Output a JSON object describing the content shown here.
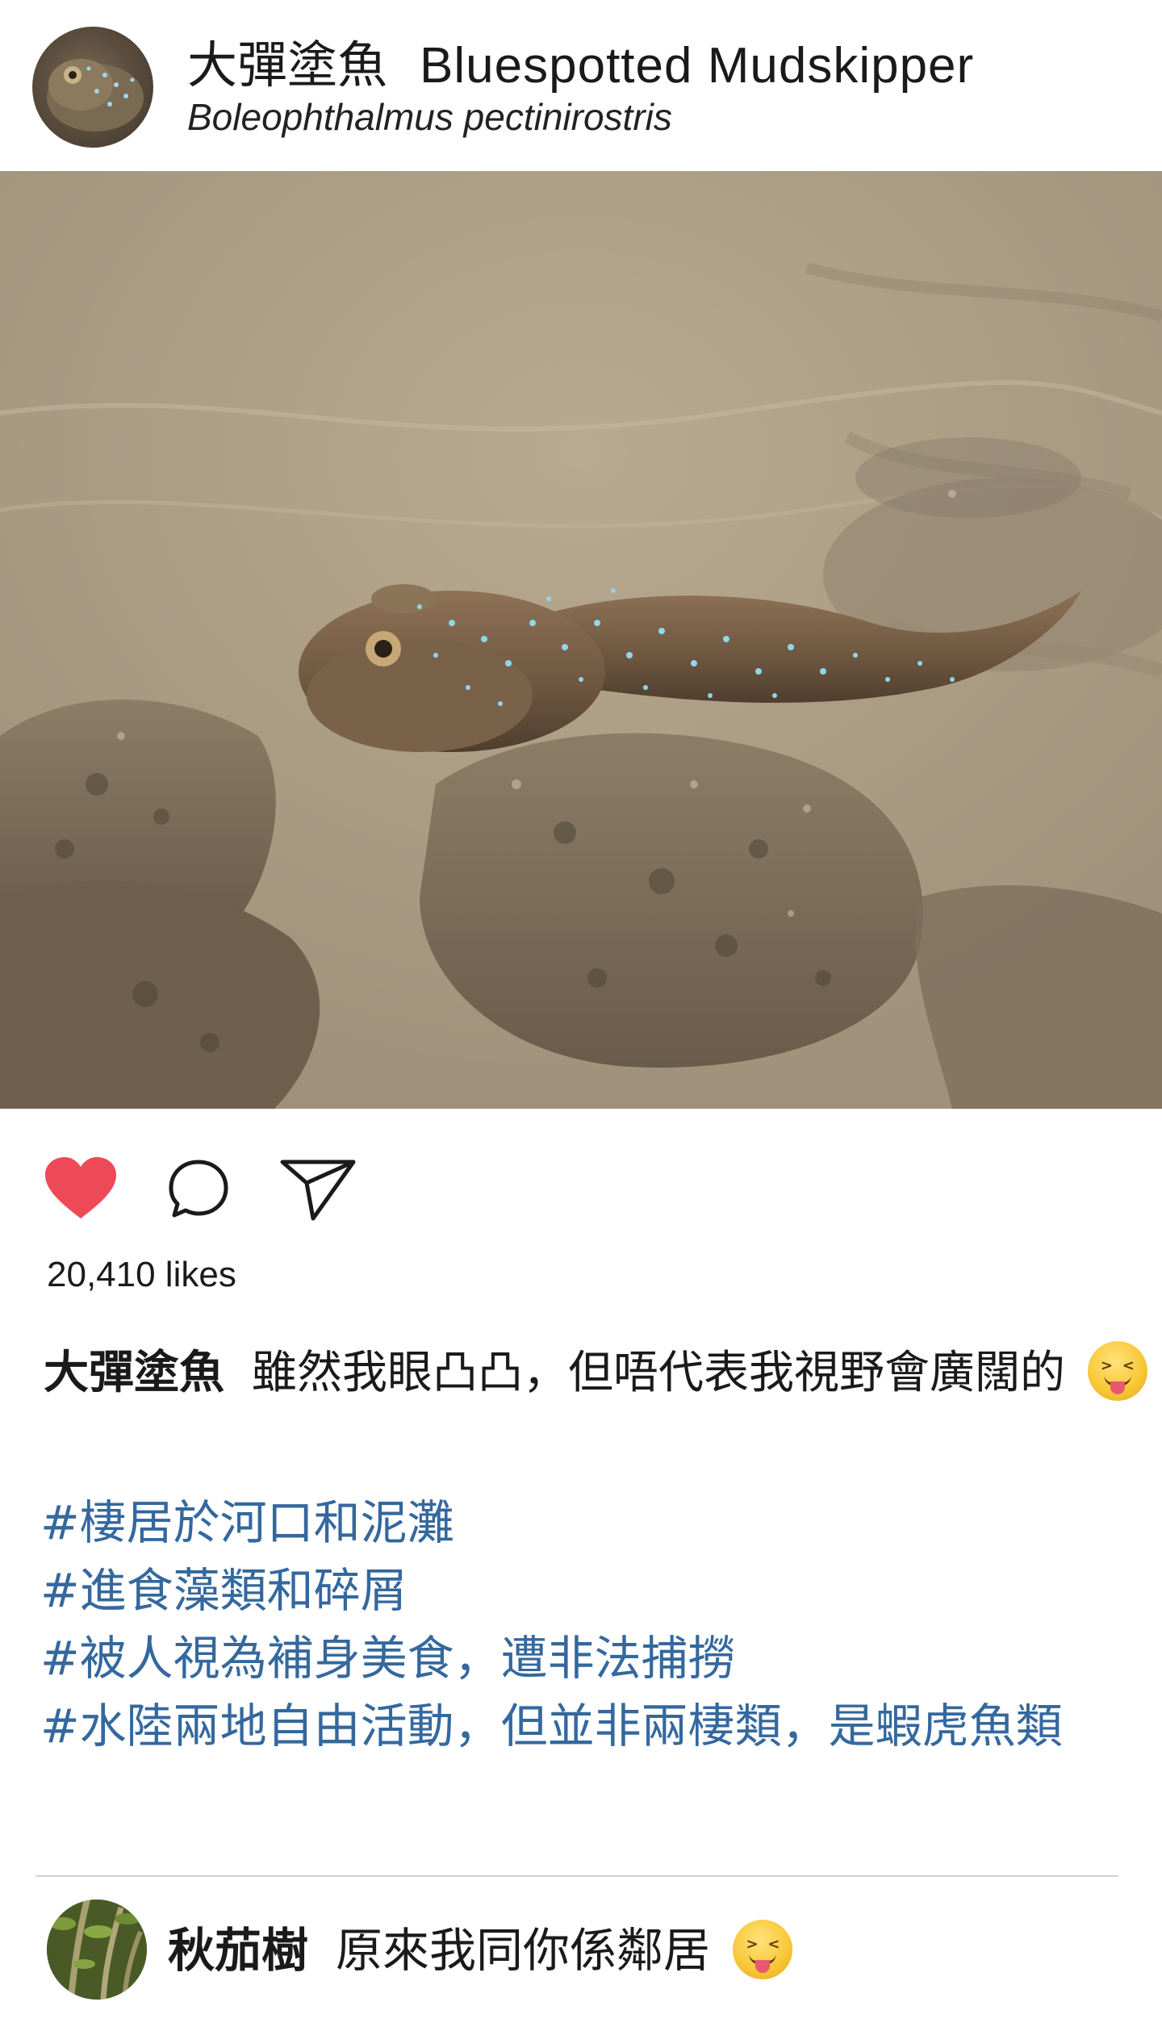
{
  "header": {
    "name_zh": "大彈塗魚",
    "name_en": "Bluespotted Mudskipper",
    "scientific_name": "Boleophthalmus pectinirostris"
  },
  "icons": {
    "like": "heart-icon",
    "comment": "comment-bubble-icon",
    "share": "send-paper-plane-icon"
  },
  "colors": {
    "like_red": "#ed4956",
    "hashtag_blue": "#34689e",
    "divider": "#d2d2d2"
  },
  "post": {
    "likes": "20,410 likes",
    "caption_user": "大彈塗魚",
    "caption_text": "雖然我眼凸凸，但唔代表我視野會廣闊的",
    "caption_emoji": "squinting-face-with-tongue",
    "hashtags": [
      "#棲居於河口和泥灘",
      "#進食藻類和碎屑",
      "#被人視為補身美食，遭非法捕撈",
      "#水陸兩地自由活動，但並非兩棲類，是蝦虎魚類"
    ]
  },
  "comment": {
    "user": "秋茄樹",
    "text": "原來我同你係鄰居",
    "emoji": "squinting-face-with-tongue"
  }
}
